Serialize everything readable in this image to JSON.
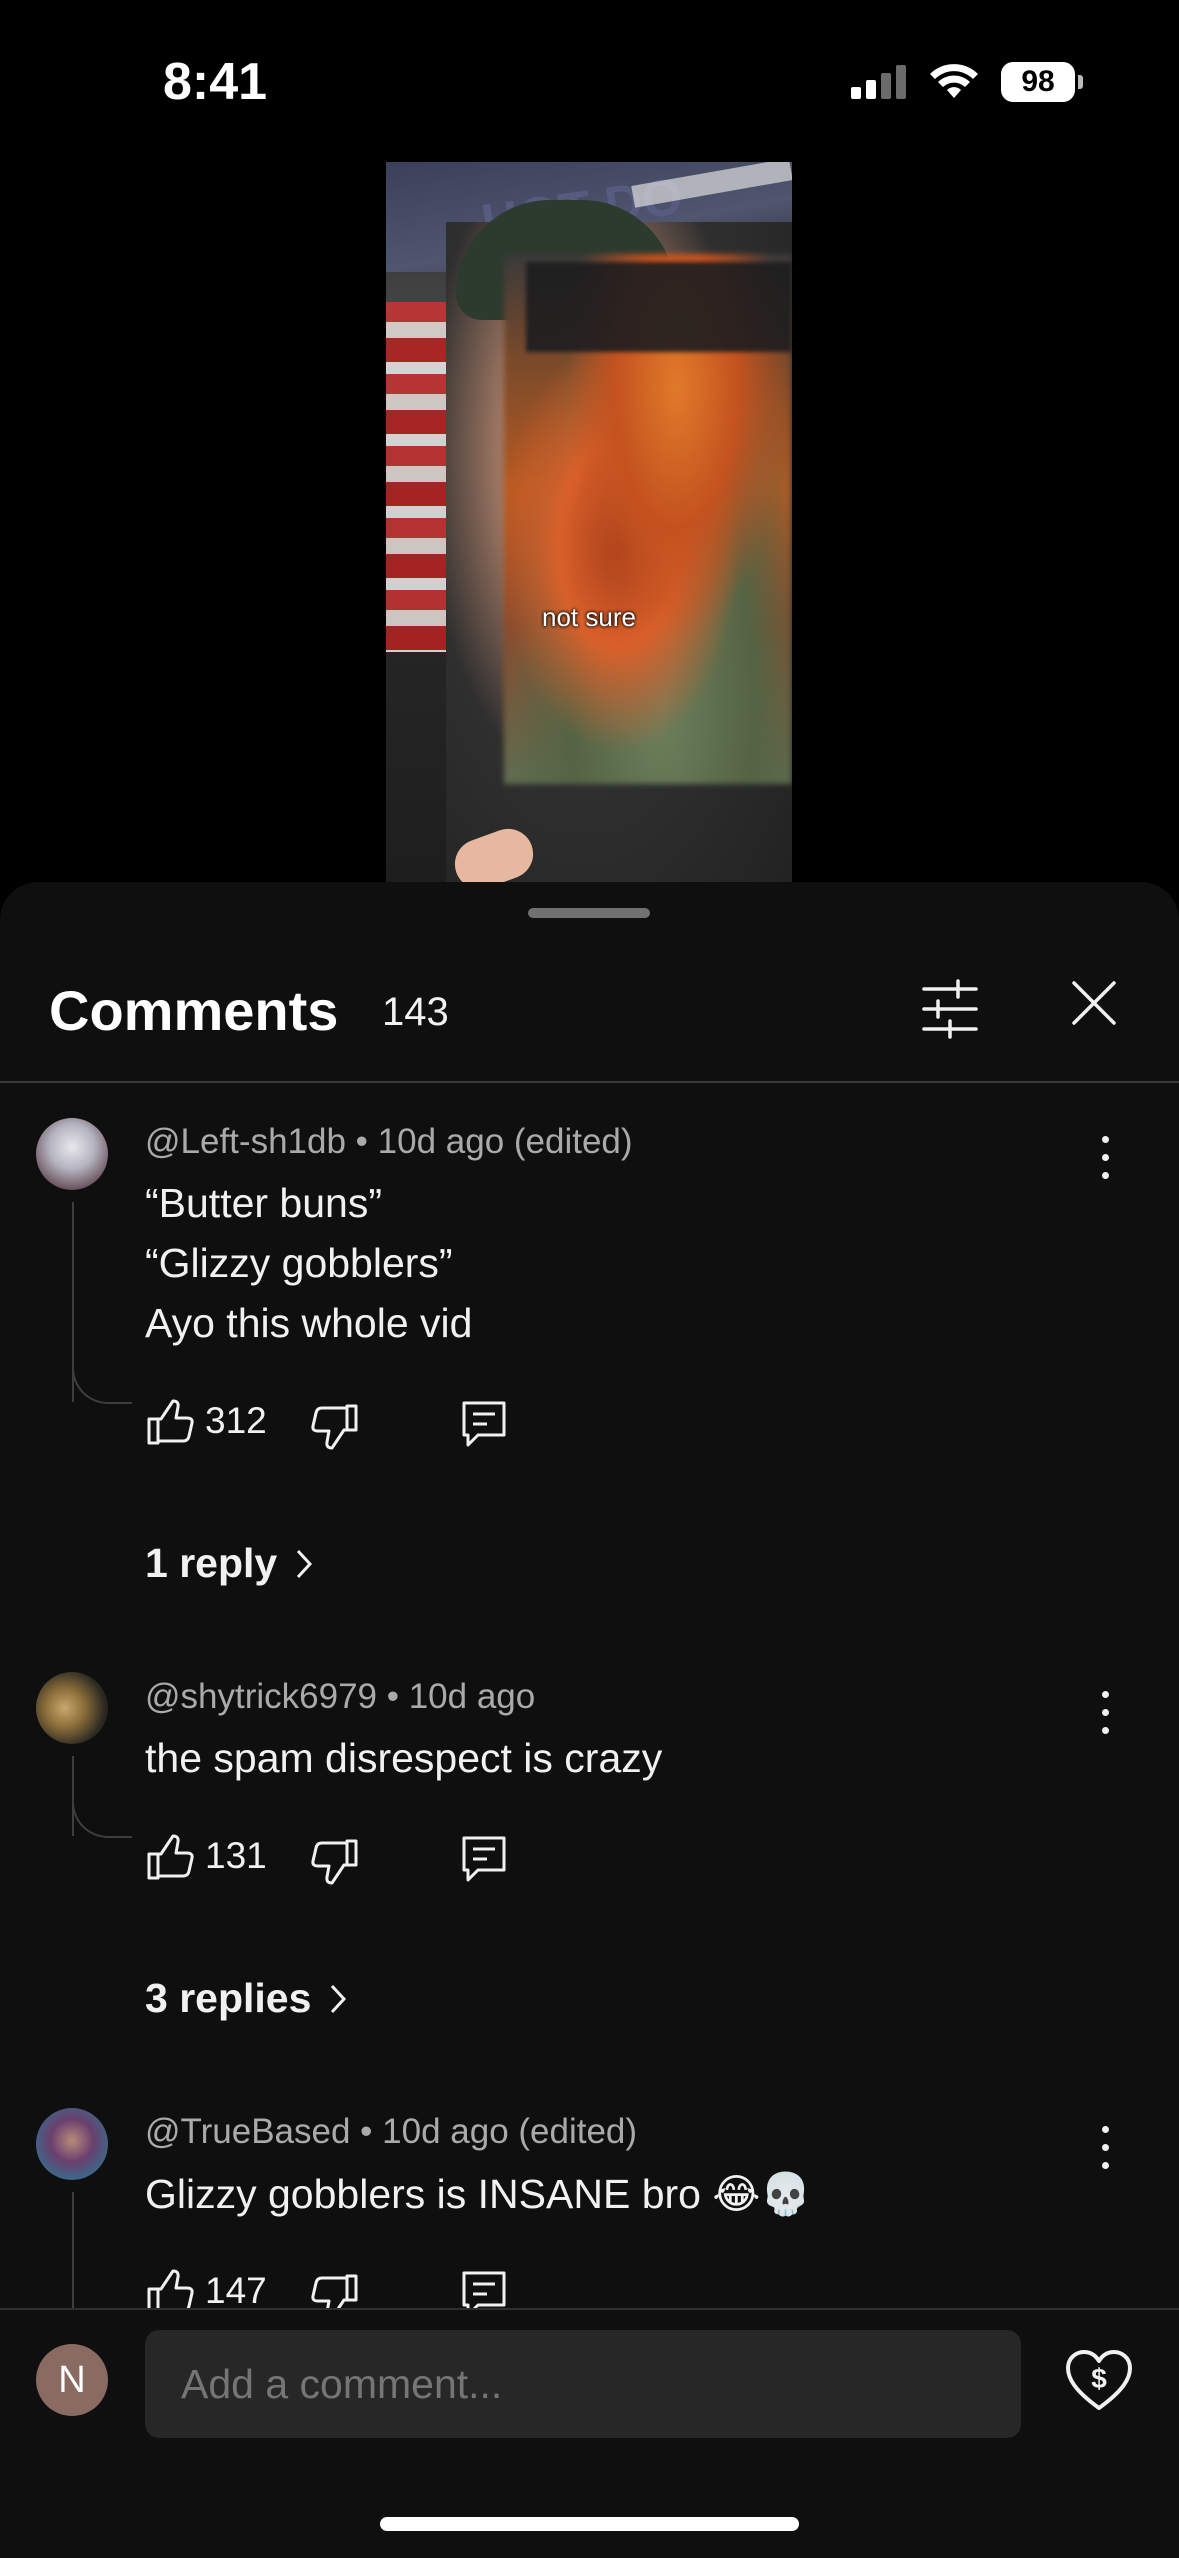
{
  "status_bar": {
    "time": "8:41",
    "battery": "98"
  },
  "video": {
    "caption": "not sure",
    "sign_text": "HOT DO"
  },
  "sheet": {
    "title": "Comments",
    "count": "143"
  },
  "comments": [
    {
      "author": "@Left-sh1db",
      "time": "10d ago (edited)",
      "lines": [
        "“Butter buns”",
        "“Glizzy gobblers”",
        "Ayo this whole vid"
      ],
      "likes": "312",
      "replies": "1 reply"
    },
    {
      "author": "@shytrick6979",
      "time": "10d ago",
      "lines": [
        "the spam disrespect is crazy"
      ],
      "likes": "131",
      "replies": "3 replies"
    },
    {
      "author": "@TrueBased",
      "time": "10d ago (edited)",
      "lines": [
        "Glizzy gobblers is INSANE bro 😂💀"
      ],
      "likes": "147"
    }
  ],
  "composer": {
    "avatar_initial": "N",
    "placeholder": "Add a comment..."
  },
  "meta_separator": " • ",
  "icons": [
    "signal-icon",
    "wifi-icon",
    "battery-icon",
    "filter-icon",
    "close-icon",
    "more-icon",
    "like-icon",
    "dislike-icon",
    "reply-icon",
    "chevron-right-icon",
    "thanks-icon"
  ]
}
